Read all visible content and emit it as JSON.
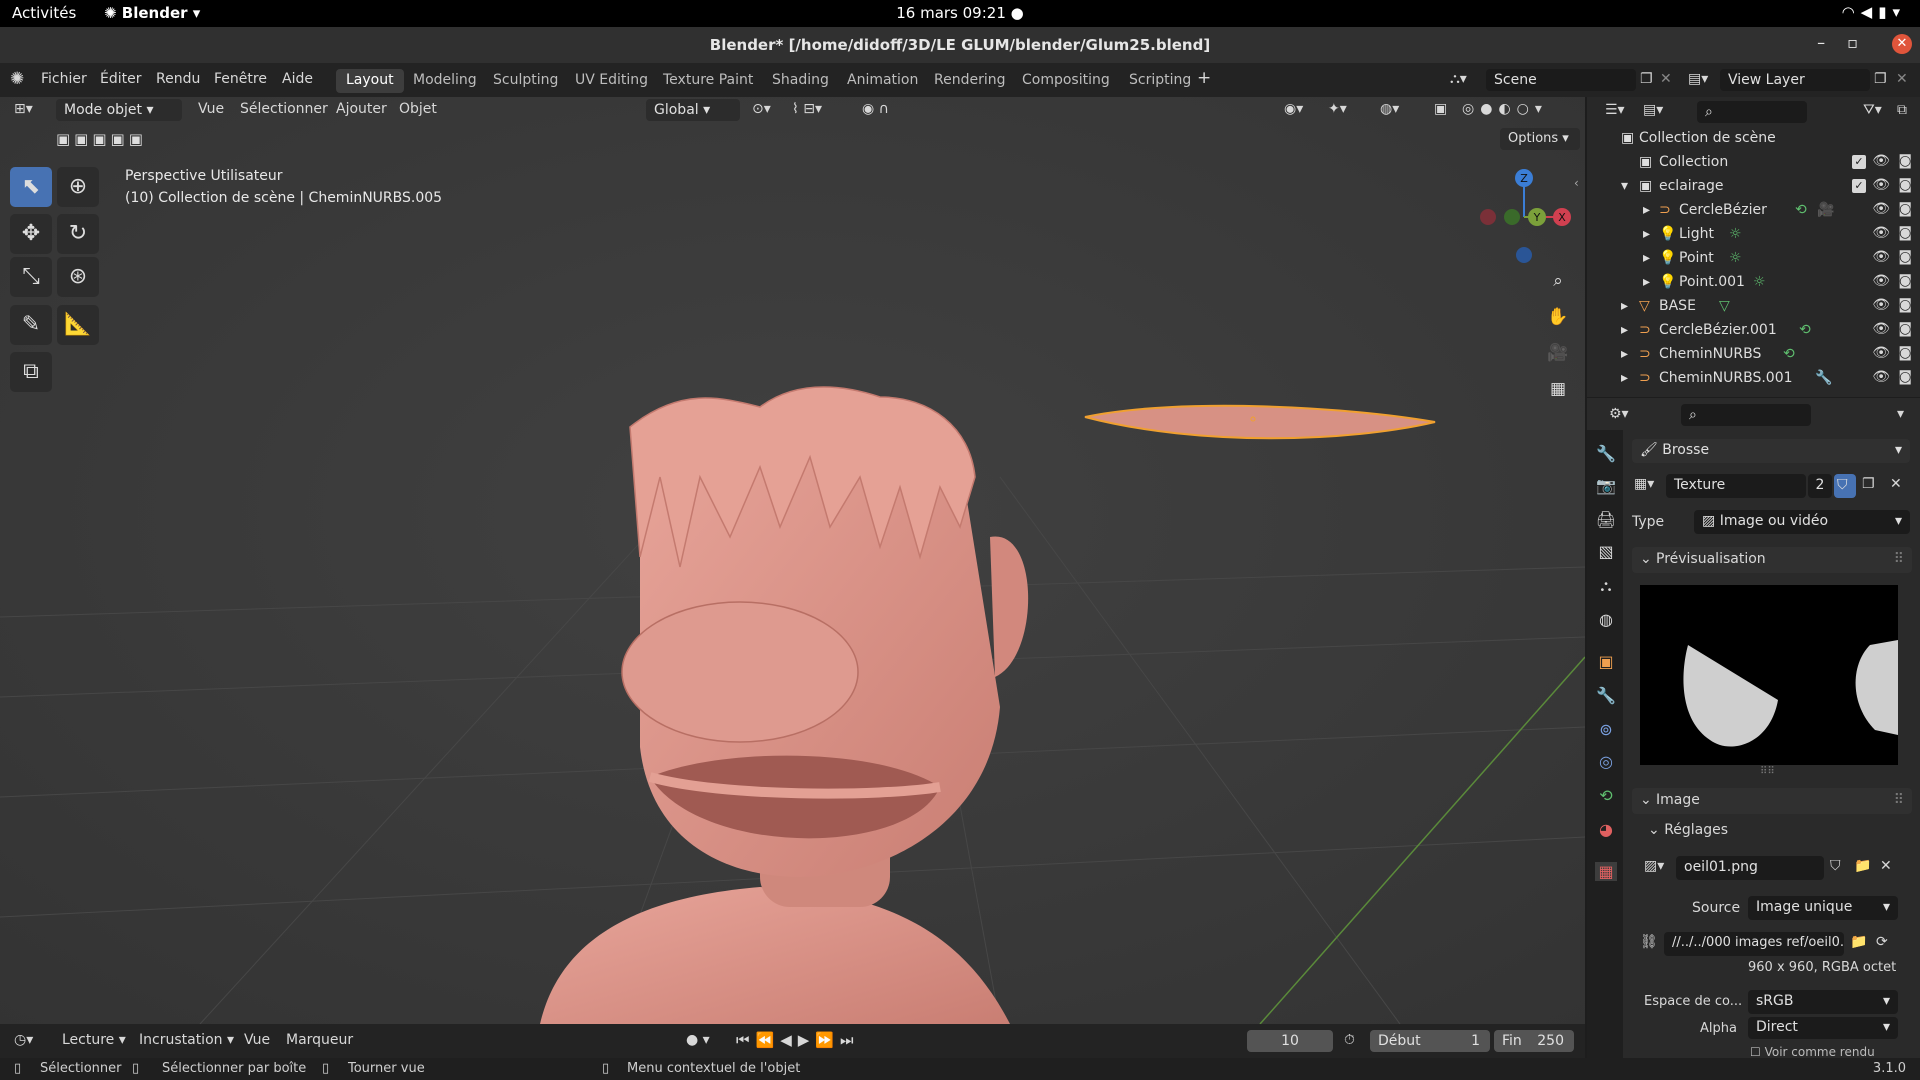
{
  "gnome": {
    "activities": "Activités",
    "app": "Blender",
    "clock": "16 mars  09:21"
  },
  "title": "Blender* [/home/didoff/3D/LE GLUM/blender/Glum25.blend]",
  "menu": {
    "file": "Fichier",
    "edit": "Éditer",
    "render": "Rendu",
    "window": "Fenêtre",
    "help": "Aide"
  },
  "workspaces": [
    "Layout",
    "Modeling",
    "Sculpting",
    "UV Editing",
    "Texture Paint",
    "Shading",
    "Animation",
    "Rendering",
    "Compositing",
    "Scripting"
  ],
  "scene": "Scene",
  "view_layer": "View Layer",
  "viewport": {
    "mode": "Mode objet",
    "view": "Vue",
    "select": "Sélectionner",
    "add": "Ajouter",
    "object": "Objet",
    "orientation": "Global",
    "options": "Options",
    "overlay_title": "Perspective Utilisateur",
    "overlay_sub": "(10) Collection de scène | CheminNURBS.005",
    "axes": {
      "z": "Z",
      "y": "Y",
      "x": "X"
    }
  },
  "outliner": {
    "root": "Collection de scène",
    "rows": [
      {
        "label": "Collection"
      },
      {
        "label": "eclairage"
      },
      {
        "label": "CercleBézier"
      },
      {
        "label": "Light"
      },
      {
        "label": "Point"
      },
      {
        "label": "Point.001"
      },
      {
        "label": "BASE"
      },
      {
        "label": "CercleBézier.001"
      },
      {
        "label": "CheminNURBS"
      },
      {
        "label": "CheminNURBS.001"
      }
    ]
  },
  "props": {
    "brush": "Brosse",
    "texture": "Texture",
    "texture_users": "2",
    "type_label": "Type",
    "type_value": "Image ou vidéo",
    "preview": "Prévisualisation",
    "image_section": "Image",
    "settings": "Réglages",
    "image_name": "oeil01.png",
    "source_label": "Source",
    "source_value": "Image unique",
    "path": "//../../000 images ref/oeil0...",
    "info": "960 x 960,  RGBA octet",
    "colorspace_label": "Espace de co...",
    "colorspace_value": "sRGB",
    "alpha_label": "Alpha",
    "alpha_value": "Direct",
    "more": "Voir comme rendu"
  },
  "timeline": {
    "playback": "Lecture",
    "keying": "Incrustation",
    "view": "Vue",
    "marker": "Marqueur",
    "frame": "10",
    "start_label": "Début",
    "start": "1",
    "end_label": "Fin",
    "end": "250"
  },
  "status": {
    "select": "Sélectionner",
    "box": "Sélectionner par boîte",
    "rotate": "Tourner vue",
    "context": "Menu contextuel de l'objet",
    "version": "3.1.0"
  }
}
